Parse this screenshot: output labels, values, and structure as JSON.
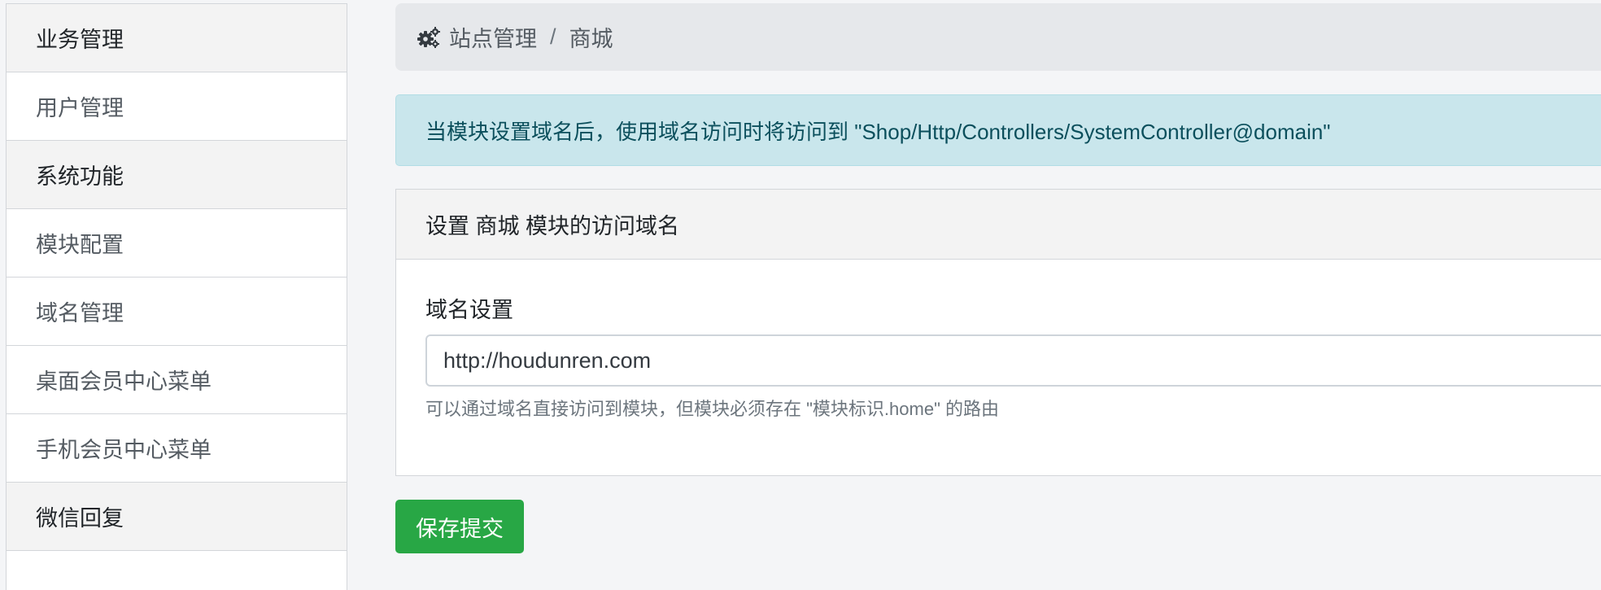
{
  "sidebar": {
    "items": [
      {
        "label": "业务管理",
        "type": "header"
      },
      {
        "label": "用户管理",
        "type": "item"
      },
      {
        "label": "系统功能",
        "type": "header"
      },
      {
        "label": "模块配置",
        "type": "item"
      },
      {
        "label": "域名管理",
        "type": "item"
      },
      {
        "label": "桌面会员中心菜单",
        "type": "item"
      },
      {
        "label": "手机会员中心菜单",
        "type": "item"
      },
      {
        "label": "微信回复",
        "type": "header"
      }
    ]
  },
  "breadcrumb": {
    "icon": "gears-icon",
    "items": [
      "站点管理",
      "商城"
    ],
    "separator": "/"
  },
  "alert": {
    "text": "当模块设置域名后，使用域名访问时将访问到 \"Shop/Http/Controllers/SystemController@domain\""
  },
  "card": {
    "title": "设置 商城 模块的访问域名",
    "field": {
      "label": "域名设置",
      "value": "http://houdunren.com",
      "help": "可以通过域名直接访问到模块，但模块必须存在 \"模块标识.home\" 的路由"
    }
  },
  "form": {
    "submit_label": "保存提交"
  },
  "colors": {
    "primary_button": "#28a745",
    "alert_bg": "#c9e6ec",
    "alert_text": "#0b4f5c"
  }
}
